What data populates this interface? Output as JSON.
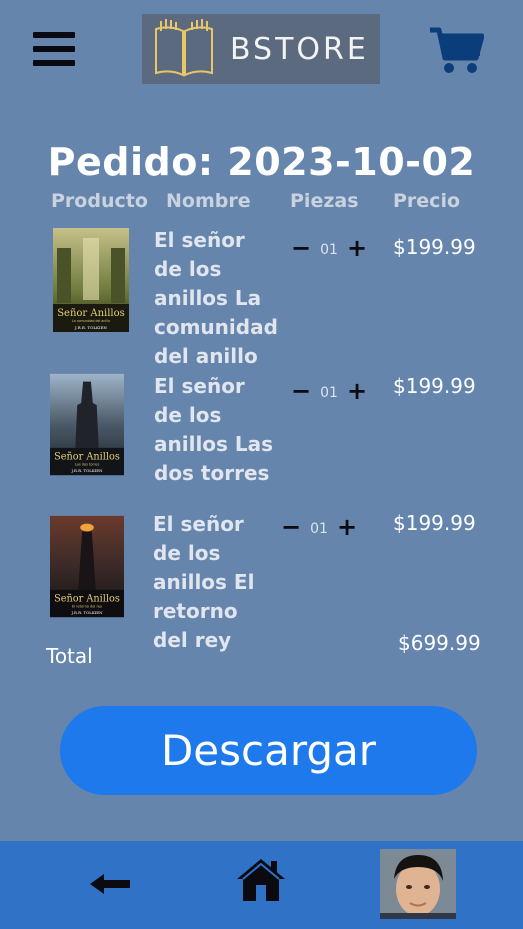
{
  "header": {
    "brand_name": "BSTORE",
    "menu_icon": "hamburger-menu-icon",
    "cart_icon": "shopping-cart-icon",
    "colors": {
      "background": "#6585ad",
      "cart": "#0b3d7a",
      "button": "#1d79ec",
      "bottom_bar": "#2f72c6"
    }
  },
  "order": {
    "title": "Pedido: 2023-10-02",
    "columns": [
      "Producto",
      "Nombre",
      "Piezas",
      "Precio"
    ],
    "items": [
      {
        "name": "El señor de los anillos La comunidad del anillo",
        "qty": "01",
        "price": "$199.99",
        "cover": {
          "title": "Señor Anillos",
          "subtitle": "La comunidad del anillo",
          "author": "J.R.R. TOLKIEN"
        }
      },
      {
        "name": "El señor de los anillos Las dos torres",
        "qty": "01",
        "price": "$199.99",
        "cover": {
          "title": "Señor Anillos",
          "subtitle": "Las dos torres",
          "author": "J.R.R. TOLKIEN"
        }
      },
      {
        "name": "El señor de los anillos El retorno del rey",
        "qty": "01",
        "price": "$199.99",
        "cover": {
          "title": "Señor Anillos",
          "subtitle": "El retorno del rey",
          "author": "J.R.R. TOLKIEN"
        }
      }
    ],
    "qty_minus": "−",
    "qty_plus": "+",
    "total_label": "Total",
    "total_value": "$699.99"
  },
  "actions": {
    "download_label": "Descargar"
  },
  "bottom_nav": {
    "back_icon": "back-arrow-icon",
    "home_icon": "home-icon",
    "profile": "user-avatar"
  }
}
